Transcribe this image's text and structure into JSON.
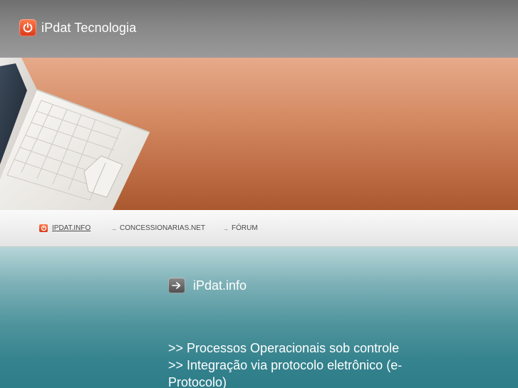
{
  "header": {
    "brand_icon": "power-icon",
    "title": "iPdat Tecnologia"
  },
  "banner": {
    "image": "laptop-keyboard-photo"
  },
  "nav": {
    "items": [
      {
        "label": "IPDAT.INFO",
        "icon": "power-icon",
        "active": true
      },
      {
        "label": "CONCESSIONARIAS.NET",
        "icon": "arrow-right-icon",
        "active": false
      },
      {
        "label": "FÓRUM",
        "icon": "arrow-right-icon",
        "active": false
      }
    ]
  },
  "content": {
    "title_icon": "arrow-right-icon",
    "title": "iPdat.info",
    "features": [
      ">>  Processos Operacionais sob controle",
      ">>  Integração via protocolo eletrônico (e-Protocolo)"
    ]
  },
  "colors": {
    "header_gray": "#8a8a8a",
    "banner_orange": "#c87a52",
    "content_teal": "#35838e",
    "brand_red": "#e14a24"
  }
}
